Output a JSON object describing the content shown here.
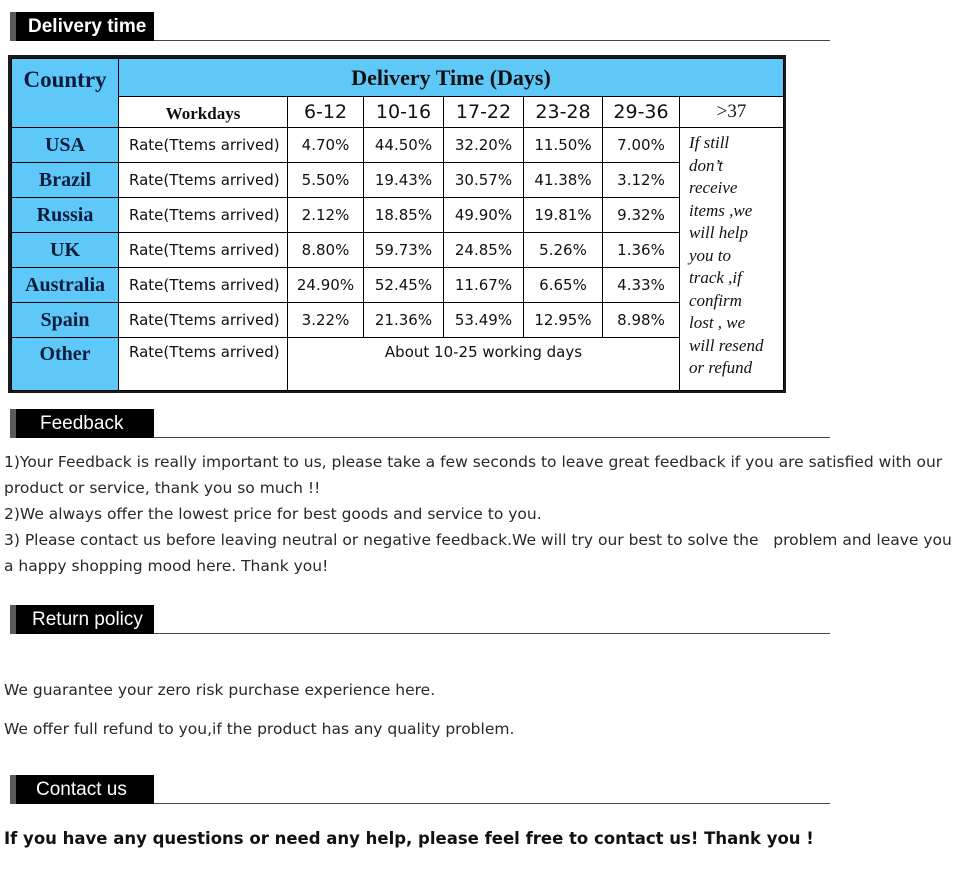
{
  "sections": {
    "delivery": {
      "title": "Delivery time"
    },
    "feedback": {
      "title": "Feedback"
    },
    "return": {
      "title": "Return policy"
    },
    "contact": {
      "title": "Contact us"
    }
  },
  "delivery_table": {
    "country_header": "Country",
    "title": "Delivery Time (Days)",
    "workdays_label": "Workdays",
    "ranges": [
      "6-12",
      "10-16",
      "17-22",
      "23-28",
      "29-36",
      ">37"
    ],
    "rows": [
      {
        "country": "USA",
        "label": "Rate(Ttems arrived)",
        "values": [
          "4.70%",
          "44.50%",
          "32.20%",
          "11.50%",
          "7.00%"
        ]
      },
      {
        "country": "Brazil",
        "label": "Rate(Ttems arrived)",
        "values": [
          "5.50%",
          "19.43%",
          "30.57%",
          "41.38%",
          "3.12%"
        ]
      },
      {
        "country": "Russia",
        "label": "Rate(Ttems arrived)",
        "values": [
          "2.12%",
          "18.85%",
          "49.90%",
          "19.81%",
          "9.32%"
        ]
      },
      {
        "country": "UK",
        "label": "Rate(Ttems arrived)",
        "values": [
          "8.80%",
          "59.73%",
          "24.85%",
          "5.26%",
          "1.36%"
        ]
      },
      {
        "country": "Australia",
        "label": "Rate(Ttems arrived)",
        "values": [
          "24.90%",
          "52.45%",
          "11.67%",
          "6.65%",
          "4.33%"
        ]
      },
      {
        "country": "Spain",
        "label": "Rate(Ttems arrived)",
        "values": [
          "3.22%",
          "21.36%",
          "53.49%",
          "12.95%",
          "8.98%"
        ]
      }
    ],
    "other": {
      "country": "Other",
      "label": "Rate(Ttems arrived)",
      "text": "About 10-25 working days"
    },
    "note_lines": [
      "If still",
      "don’t",
      "receive",
      "items ,we",
      "will help",
      "you to",
      "track ,if",
      "confirm",
      "lost , we",
      "will resend",
      "or refund"
    ]
  },
  "feedback": {
    "item1": "1)Your Feedback is really important to us, please take a few seconds to leave great feedback if you are satisfied with our product or service, thank you so much !!",
    "item2": "2)We always offer the lowest price for best goods and service to you.",
    "item3": "3) Please contact us before leaving neutral or negative feedback.We will try our best to solve the   problem and leave you a happy shopping mood here. Thank you!"
  },
  "return_policy": {
    "line1": "We guarantee your zero risk purchase experience here.",
    "line2": "We offer full refund to you,if the product has any quality problem."
  },
  "contact": {
    "text": "If you have any questions or need any help, please feel free to contact us! Thank you !"
  },
  "colors": {
    "table_header_blue": "#5ec8f8",
    "tab_black": "#000000"
  }
}
